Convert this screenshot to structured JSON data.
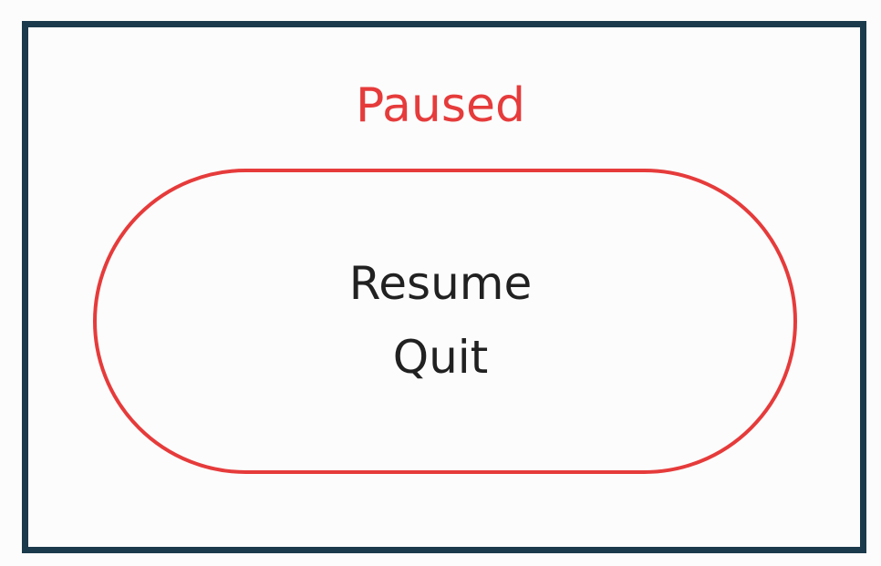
{
  "pause_menu": {
    "title": "Paused",
    "resume_label": "Resume",
    "quit_label": "Quit"
  },
  "colors": {
    "accent": "#e63b3b",
    "frame": "#1b3a4b",
    "text": "#212121",
    "background": "#fcfcfc"
  }
}
